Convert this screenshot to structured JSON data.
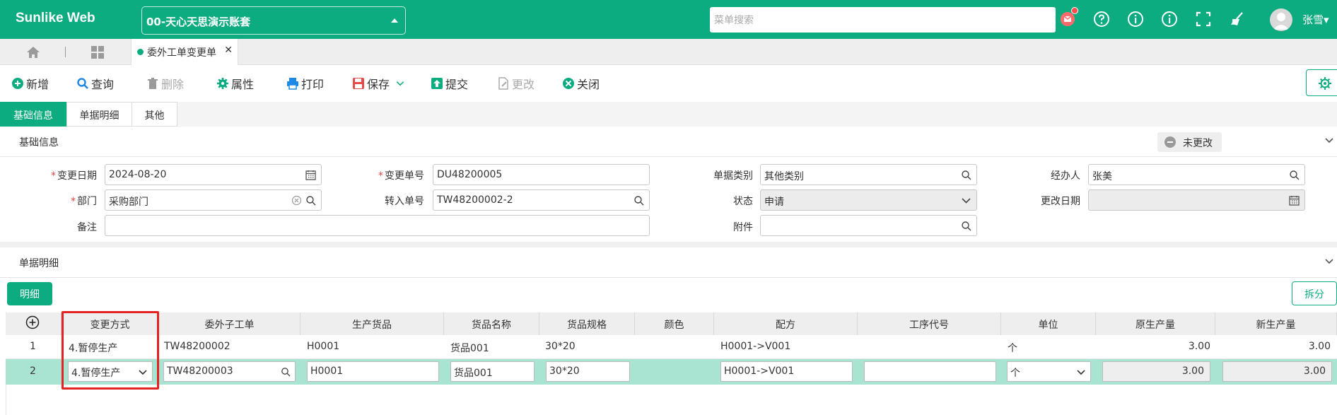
{
  "header": {
    "brand": "Sunlike Web",
    "account": "00-天心天思演示账套",
    "search_placeholder": "菜单搜索",
    "user": "张雪"
  },
  "tabs": {
    "active_tab": "委外工单变更单"
  },
  "toolbar": {
    "add": "新增",
    "query": "查询",
    "delete": "删除",
    "property": "属性",
    "print": "打印",
    "save": "保存",
    "submit": "提交",
    "modify": "更改",
    "close": "关闭"
  },
  "section_tabs": [
    "基础信息",
    "单据明细",
    "其他"
  ],
  "basic": {
    "title": "基础信息",
    "status_pill": "未更改",
    "fields": {
      "change_date_label": "变更日期",
      "change_date": "2024-08-20",
      "change_no_label": "变更单号",
      "change_no": "DU48200005",
      "doc_type_label": "单据类别",
      "doc_type": "其他类别",
      "handler_label": "经办人",
      "handler": "张美",
      "dept_label": "部门",
      "dept": "采购部门",
      "transfer_no_label": "转入单号",
      "transfer_no": "TW48200002-2",
      "status_label": "状态",
      "status": "申请",
      "modify_date_label": "更改日期",
      "modify_date": "",
      "remark_label": "备注",
      "remark": "",
      "attachment_label": "附件",
      "attachment": ""
    }
  },
  "detail": {
    "title": "单据明细",
    "detail_button": "明细",
    "split_button": "拆分",
    "columns": [
      "变更方式",
      "委外子工单",
      "生产货品",
      "货品名称",
      "货品规格",
      "颜色",
      "配方",
      "工序代号",
      "单位",
      "原生产量",
      "新生产量"
    ],
    "rows": [
      {
        "no": "1",
        "change_mode": "4.暂停生产",
        "sub_order": "TW48200002",
        "product": "H0001",
        "product_name": "货品001",
        "spec": "30*20",
        "color": "",
        "formula": "H0001->V001",
        "process": "",
        "unit": "个",
        "orig_qty": "3.00",
        "new_qty": "3.00"
      },
      {
        "no": "2",
        "change_mode": "4.暂停生产",
        "sub_order": "TW48200003",
        "product": "H0001",
        "product_name": "货品001",
        "spec": "30*20",
        "color": "",
        "formula": "H0001->V001",
        "process": "",
        "unit": "个",
        "orig_qty": "3.00",
        "new_qty": "3.00"
      }
    ]
  },
  "colors": {
    "primary": "#0cab80",
    "selected_row": "#a9e3d2",
    "highlight": "#e52222"
  }
}
